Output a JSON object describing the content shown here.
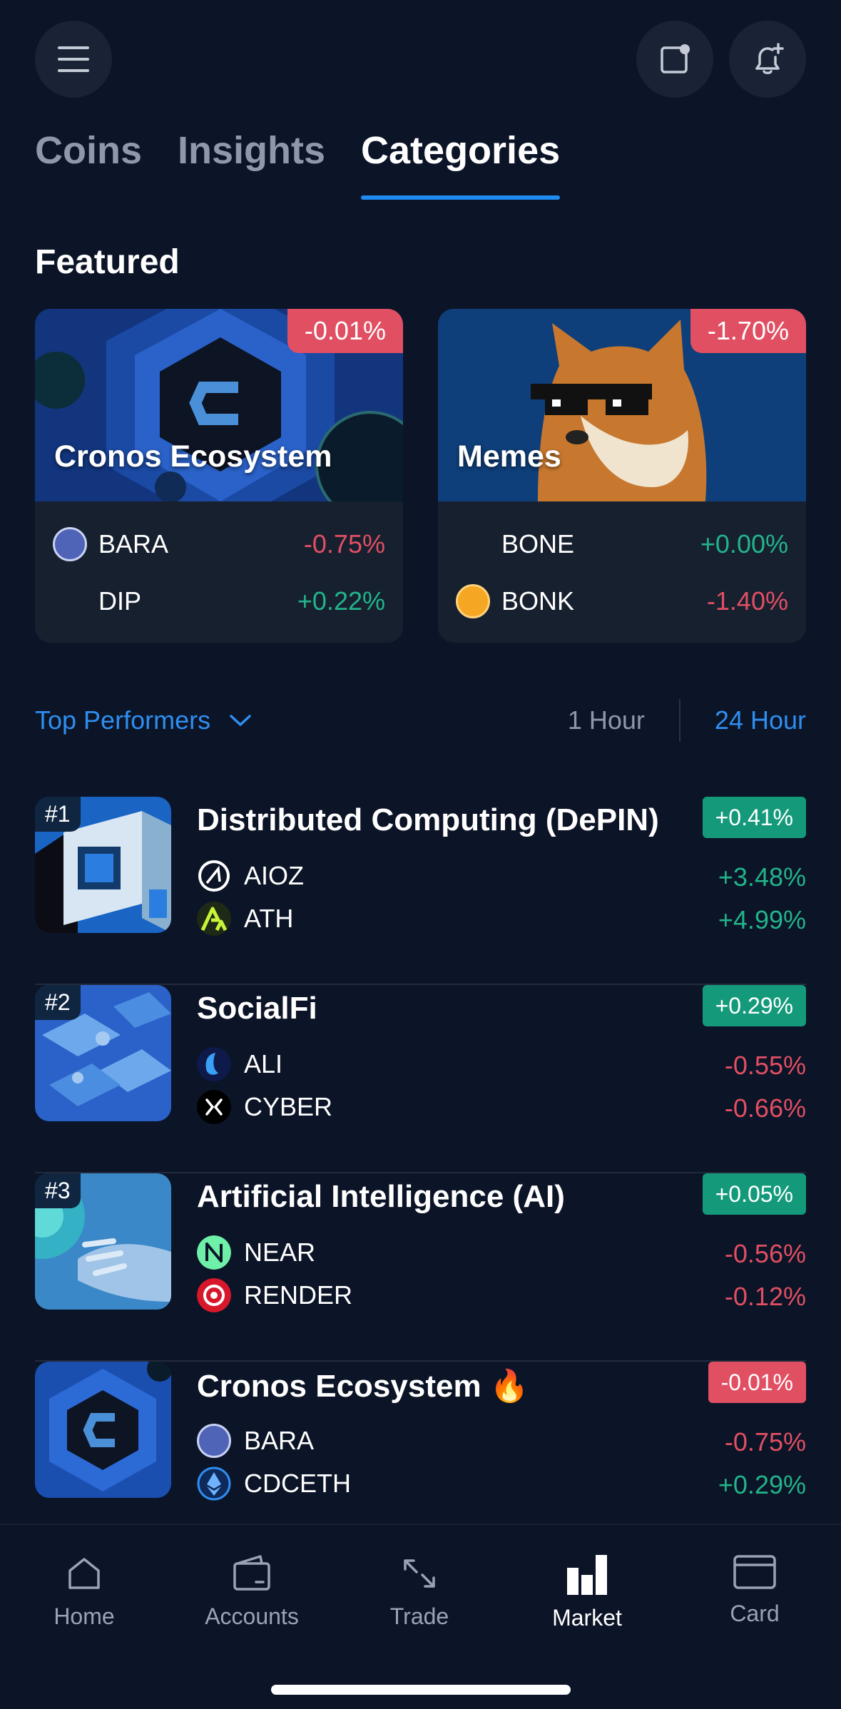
{
  "header": {
    "menu_icon": "hamburger-icon",
    "actions": [
      "notes-icon",
      "add-alert-icon"
    ]
  },
  "tabs": [
    {
      "label": "Coins",
      "active": false
    },
    {
      "label": "Insights",
      "active": false
    },
    {
      "label": "Categories",
      "active": true
    }
  ],
  "featured": {
    "title": "Featured",
    "cards": [
      {
        "name": "Cronos Ecosystem",
        "change": "-0.01%",
        "coins": [
          {
            "symbol": "BARA",
            "change": "-0.75%"
          },
          {
            "symbol": "DIP",
            "change": "+0.22%"
          }
        ]
      },
      {
        "name": "Memes",
        "change": "-1.70%",
        "coins": [
          {
            "symbol": "BONE",
            "change": "+0.00%"
          },
          {
            "symbol": "BONK",
            "change": "-1.40%"
          }
        ]
      }
    ]
  },
  "filter": {
    "selector_label": "Top Performers",
    "time_options": [
      {
        "label": "1 Hour",
        "active": false
      },
      {
        "label": "24 Hour",
        "active": true
      }
    ]
  },
  "categories": [
    {
      "rank": "#1",
      "name": "Distributed Computing (DePIN)",
      "change": "+0.41%",
      "coins": [
        {
          "symbol": "AIOZ",
          "change": "+3.48%"
        },
        {
          "symbol": "ATH",
          "change": "+4.99%"
        }
      ]
    },
    {
      "rank": "#2",
      "name": "SocialFi",
      "change": "+0.29%",
      "coins": [
        {
          "symbol": "ALI",
          "change": "-0.55%"
        },
        {
          "symbol": "CYBER",
          "change": "-0.66%"
        }
      ]
    },
    {
      "rank": "#3",
      "name": "Artificial Intelligence (AI)",
      "change": "+0.05%",
      "coins": [
        {
          "symbol": "NEAR",
          "change": "-0.56%"
        },
        {
          "symbol": "RENDER",
          "change": "-0.12%"
        }
      ]
    },
    {
      "rank": "",
      "name": "Cronos Ecosystem 🔥",
      "change": "-0.01%",
      "coins": [
        {
          "symbol": "BARA",
          "change": "-0.75%"
        },
        {
          "symbol": "CDCETH",
          "change": "+0.29%"
        }
      ]
    }
  ],
  "bottom_nav": [
    {
      "label": "Home",
      "icon": "home-icon",
      "active": false
    },
    {
      "label": "Accounts",
      "icon": "wallet-icon",
      "active": false
    },
    {
      "label": "Trade",
      "icon": "trade-arrows-icon",
      "active": false
    },
    {
      "label": "Market",
      "icon": "bar-chart-icon",
      "active": true
    },
    {
      "label": "Card",
      "icon": "card-icon",
      "active": false
    }
  ],
  "colors": {
    "background": "#0c1427",
    "accent": "#1e8cf0",
    "positive": "#22b48a",
    "negative": "#e14f63"
  }
}
